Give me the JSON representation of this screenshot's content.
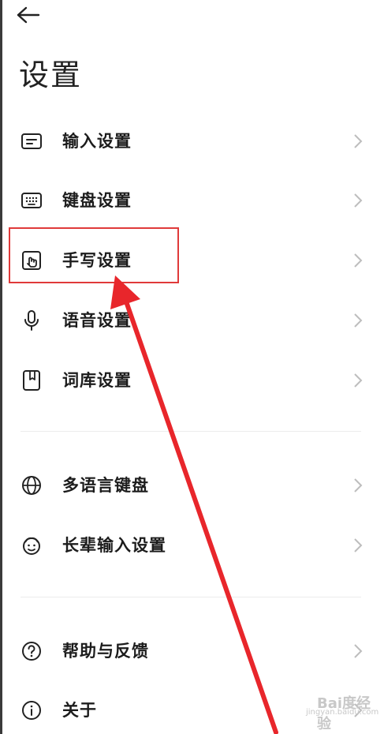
{
  "header": {
    "back_icon": "arrow-left-icon",
    "title": "设置"
  },
  "menu": {
    "group1": [
      {
        "label": "输入设置",
        "icon": "input-settings-icon"
      },
      {
        "label": "键盘设置",
        "icon": "keyboard-icon"
      },
      {
        "label": "手写设置",
        "icon": "handwriting-icon"
      },
      {
        "label": "语音设置",
        "icon": "microphone-icon"
      },
      {
        "label": "词库设置",
        "icon": "dictionary-icon"
      }
    ],
    "group2": [
      {
        "label": "多语言键盘",
        "icon": "globe-icon"
      },
      {
        "label": "长辈输入设置",
        "icon": "elder-face-icon"
      }
    ],
    "group3": [
      {
        "label": "帮助与反馈",
        "icon": "help-icon"
      },
      {
        "label": "关于",
        "icon": "info-icon"
      }
    ]
  },
  "annotation": {
    "highlight_color": "#e03a3a",
    "arrow_color": "#e8262b"
  },
  "watermark": {
    "text": "Bai度经验",
    "sub": "jingyan.baidu.com"
  }
}
